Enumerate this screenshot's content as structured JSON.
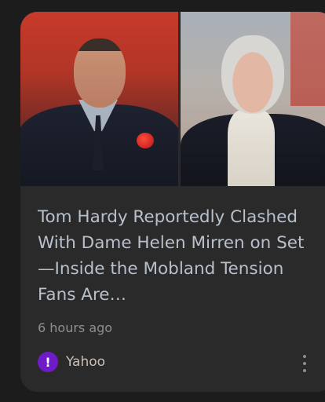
{
  "article": {
    "title": "Tom Hardy Reportedly Clashed With Dame Helen Mirren on Set—Inside the Mobland Tension Fans Are…",
    "time": "6 hours ago",
    "source": "Yahoo",
    "source_icon_glyph": "!",
    "more_icon": "more-vert-icon"
  },
  "colors": {
    "card_bg": "#2a2a2a",
    "title": "#b8c0cc",
    "yahoo_purple": "#6f1cc8"
  }
}
